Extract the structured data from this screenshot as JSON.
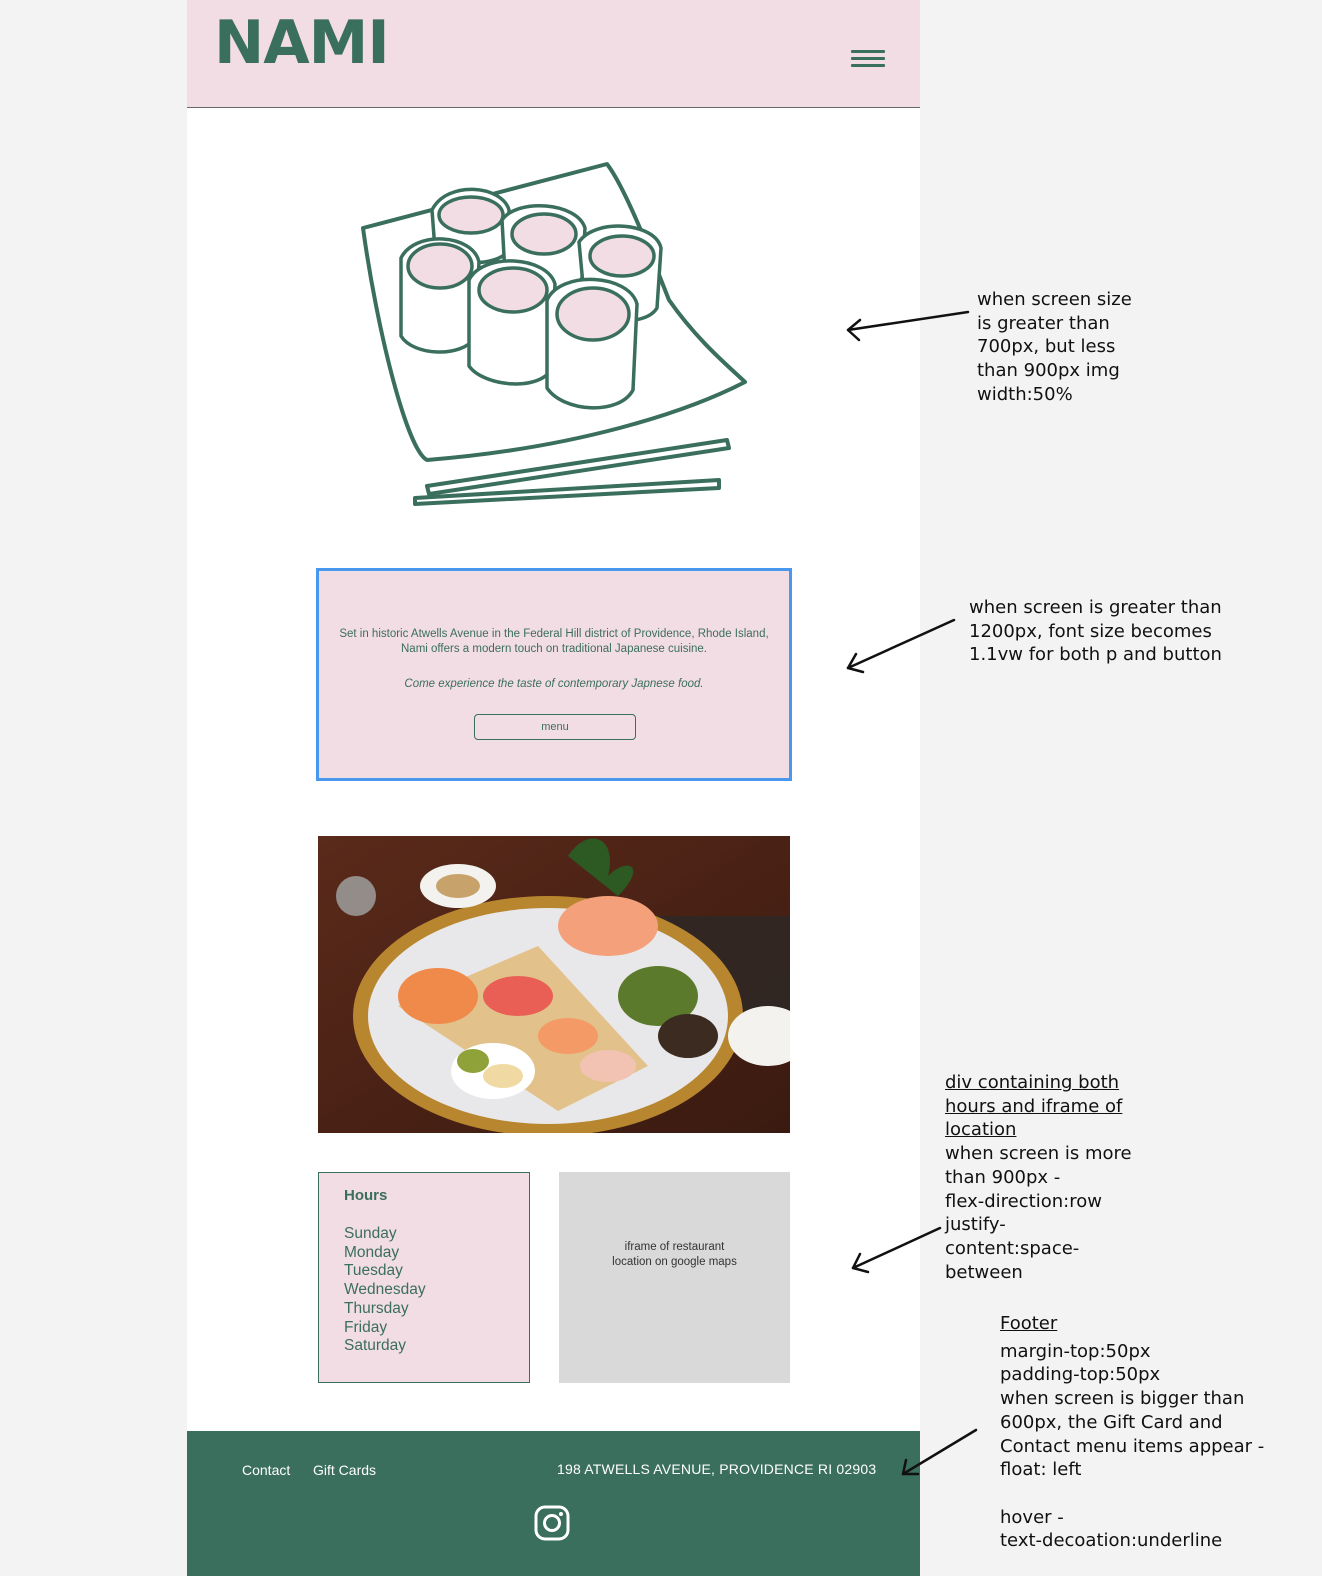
{
  "header": {
    "logo": "NAMI",
    "menu_icon": "hamburger-menu-icon"
  },
  "hero": {
    "image": "sushi-rolls-illustration"
  },
  "intro": {
    "paragraph": "Set in historic Atwells Avenue in the Federal Hill district of Providence, Rhode Island, Nami offers a modern touch on traditional Japanese cuisine.",
    "tagline": "Come experience the taste of contemporary Japnese food.",
    "button_label": "menu"
  },
  "photo": {
    "image": "sushi-platter-photo"
  },
  "hours": {
    "title": "Hours",
    "days": [
      "Sunday",
      "Monday",
      "Tuesday",
      "Wednesday",
      "Thursday",
      "Friday",
      "Saturday"
    ]
  },
  "map": {
    "placeholder_line1": "iframe of restaurant",
    "placeholder_line2": "location on  google maps"
  },
  "footer": {
    "links": [
      "Contact",
      "Gift Cards"
    ],
    "address": "198 ATWELLS AVENUE, PROVIDENCE RI 02903",
    "social_icon": "instagram-icon"
  },
  "colors": {
    "brand_green": "#3a6e5d",
    "pink": "#f3dde5",
    "highlight_blue": "#4a97ee",
    "map_gray": "#d9d9d9"
  },
  "annotations": {
    "image_note": [
      "when screen size",
      "is greater than",
      "700px, but less",
      "than 900px img",
      "width:50%"
    ],
    "font_note": [
      "when screen is greater than",
      "1200px, font size becomes",
      "1.1vw for both p and button"
    ],
    "div_note_underlined": [
      "div containing both",
      "hours and iframe of",
      "location"
    ],
    "div_note": [
      "when screen is more",
      "than 900px -",
      "flex-direction:row",
      "justify-",
      "content:space-",
      "between"
    ],
    "footer_note_title": "Footer",
    "footer_note": [
      "margin-top:50px",
      "padding-top:50px",
      "when screen is bigger than",
      "600px, the Gift Card and",
      "Contact menu items appear -",
      "float: left"
    ],
    "footer_note_hover": [
      "hover -",
      "text-decoation:underline"
    ]
  }
}
